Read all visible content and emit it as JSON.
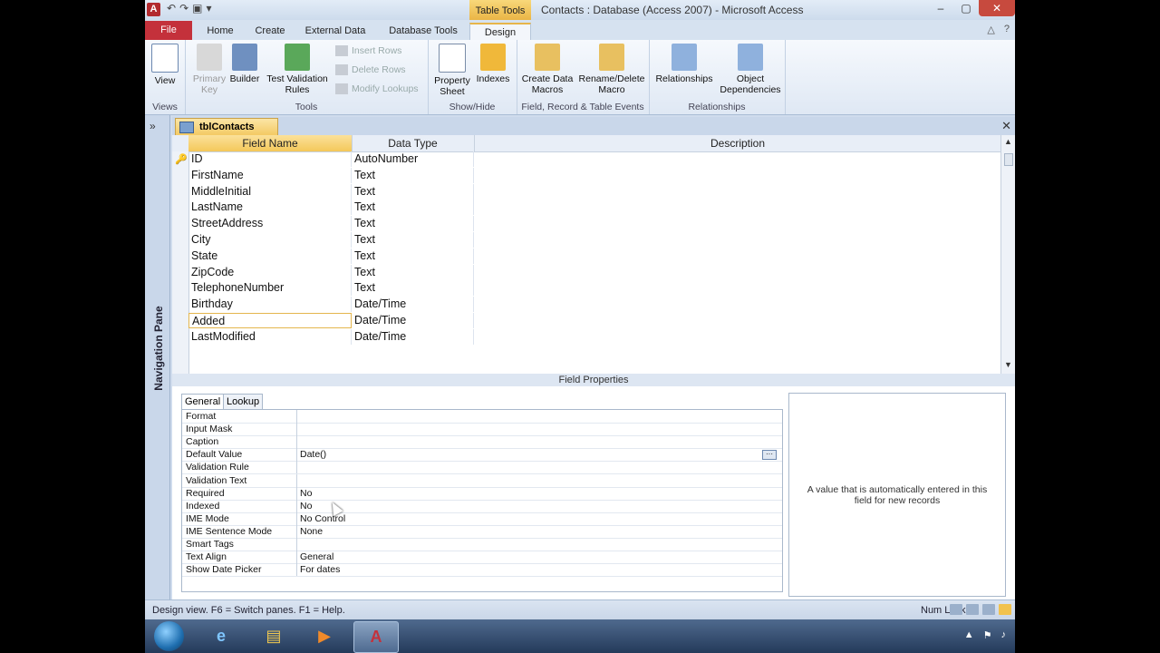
{
  "window": {
    "app_letter": "A",
    "title": "Contacts : Database (Access 2007) - Microsoft Access",
    "context_tab": "Table Tools",
    "controls": {
      "minimize": "–",
      "maximize": "▢",
      "close": "✕"
    }
  },
  "ribbon": {
    "tabs": [
      "File",
      "Home",
      "Create",
      "External Data",
      "Database Tools",
      "Design"
    ],
    "groups": {
      "views": {
        "label": "Views",
        "view": "View"
      },
      "tools": {
        "label": "Tools",
        "primary_key": "Primary Key",
        "builder": "Builder",
        "test_validation": "Test Validation Rules",
        "insert_rows": "Insert Rows",
        "delete_rows": "Delete Rows",
        "modify_lookups": "Modify Lookups"
      },
      "show_hide": {
        "label": "Show/Hide",
        "property_sheet": "Property Sheet",
        "indexes": "Indexes"
      },
      "events": {
        "label": "Field, Record & Table Events",
        "create_data_macros": "Create Data Macros",
        "rename_delete_macro": "Rename/Delete Macro"
      },
      "relationships": {
        "label": "Relationships",
        "relationships": "Relationships",
        "object_dependencies": "Object Dependencies"
      }
    }
  },
  "nav_pane": {
    "label": "Navigation Pane",
    "toggle": "»"
  },
  "document": {
    "tab": "tblContacts",
    "headers": {
      "field_name": "Field Name",
      "data_type": "Data Type",
      "description": "Description"
    },
    "fields": [
      {
        "name": "ID",
        "type": "AutoNumber"
      },
      {
        "name": "FirstName",
        "type": "Text"
      },
      {
        "name": "MiddleInitial",
        "type": "Text"
      },
      {
        "name": "LastName",
        "type": "Text"
      },
      {
        "name": "StreetAddress",
        "type": "Text"
      },
      {
        "name": "City",
        "type": "Text"
      },
      {
        "name": "State",
        "type": "Text"
      },
      {
        "name": "ZipCode",
        "type": "Text"
      },
      {
        "name": "TelephoneNumber",
        "type": "Text"
      },
      {
        "name": "Birthday",
        "type": "Date/Time"
      },
      {
        "name": "Added",
        "type": "Date/Time"
      },
      {
        "name": "LastModified",
        "type": "Date/Time"
      }
    ],
    "selected_field": "Added",
    "field_properties_label": "Field Properties",
    "prop_tabs": [
      "General",
      "Lookup"
    ],
    "properties": [
      {
        "name": "Format",
        "value": ""
      },
      {
        "name": "Input Mask",
        "value": ""
      },
      {
        "name": "Caption",
        "value": ""
      },
      {
        "name": "Default Value",
        "value": "Date()"
      },
      {
        "name": "Validation Rule",
        "value": ""
      },
      {
        "name": "Validation Text",
        "value": ""
      },
      {
        "name": "Required",
        "value": "No"
      },
      {
        "name": "Indexed",
        "value": "No"
      },
      {
        "name": "IME Mode",
        "value": "No Control"
      },
      {
        "name": "IME Sentence Mode",
        "value": "None"
      },
      {
        "name": "Smart Tags",
        "value": ""
      },
      {
        "name": "Text Align",
        "value": "General"
      },
      {
        "name": "Show Date Picker",
        "value": "For dates"
      }
    ],
    "help_text": "A value that is automatically entered in this field for new records"
  },
  "statusbar": {
    "text": "Design view.  F6 = Switch panes.  F1 = Help.",
    "num_lock": "Num Lock"
  }
}
